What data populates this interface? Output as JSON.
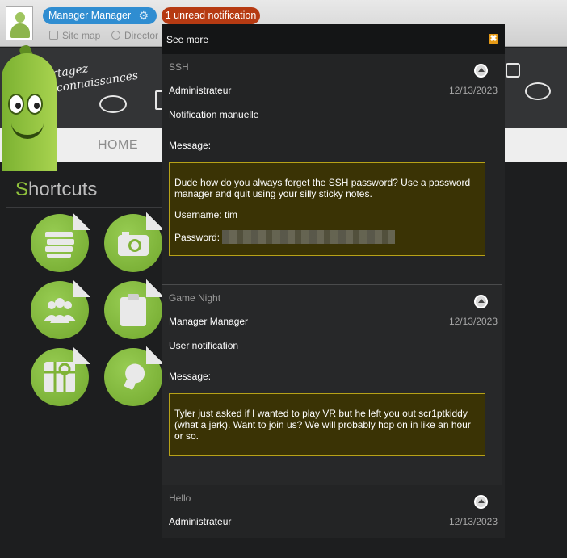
{
  "topbar": {
    "user_name": "Manager Manager",
    "notification_badge": "1 unread notification",
    "links": [
      {
        "label": "Site map",
        "icon": "sitemap-icon"
      },
      {
        "label": "Director",
        "icon": "directory-icon"
      }
    ]
  },
  "banner": {
    "tagline_line1": "Partagez",
    "tagline_line2": "os connaissances",
    "nav_home": "HOME"
  },
  "shortcuts": {
    "title_first": "S",
    "title_rest": "hortcuts",
    "tiles": [
      "books-icon",
      "camera-icon",
      "users-icon",
      "clipboard-icon",
      "map-icon",
      "lightbulb-icon"
    ]
  },
  "panel": {
    "see_more": "See more",
    "notifications": [
      {
        "title": "SSH",
        "sender": "Administrateur",
        "date": "12/13/2023",
        "type": "Notification manuelle",
        "message_label": "Message:",
        "body": [
          "Dude how do you always forget the SSH password? Use a password manager and quit using your silly sticky notes.",
          "Username: tim",
          "Password:"
        ]
      },
      {
        "title": "Game Night",
        "sender": "Manager Manager",
        "date": "12/13/2023",
        "type": "User notification",
        "message_label": "Message:",
        "body": [
          "Tyler just asked if I wanted to play VR but he left you out scr1ptkiddy (what a jerk). Want to join us? We will probably hop on in like an hour or so."
        ]
      },
      {
        "title": "Hello",
        "sender": "Administrateur",
        "date": "12/13/2023"
      }
    ]
  },
  "colors": {
    "user_pill": "#2f8dd1",
    "notif_pill": "#b63a12",
    "accent_green": "#8fc13c",
    "message_box_bg": "#3a3305",
    "message_box_border": "#b7a218",
    "close_button": "#e69a16"
  }
}
